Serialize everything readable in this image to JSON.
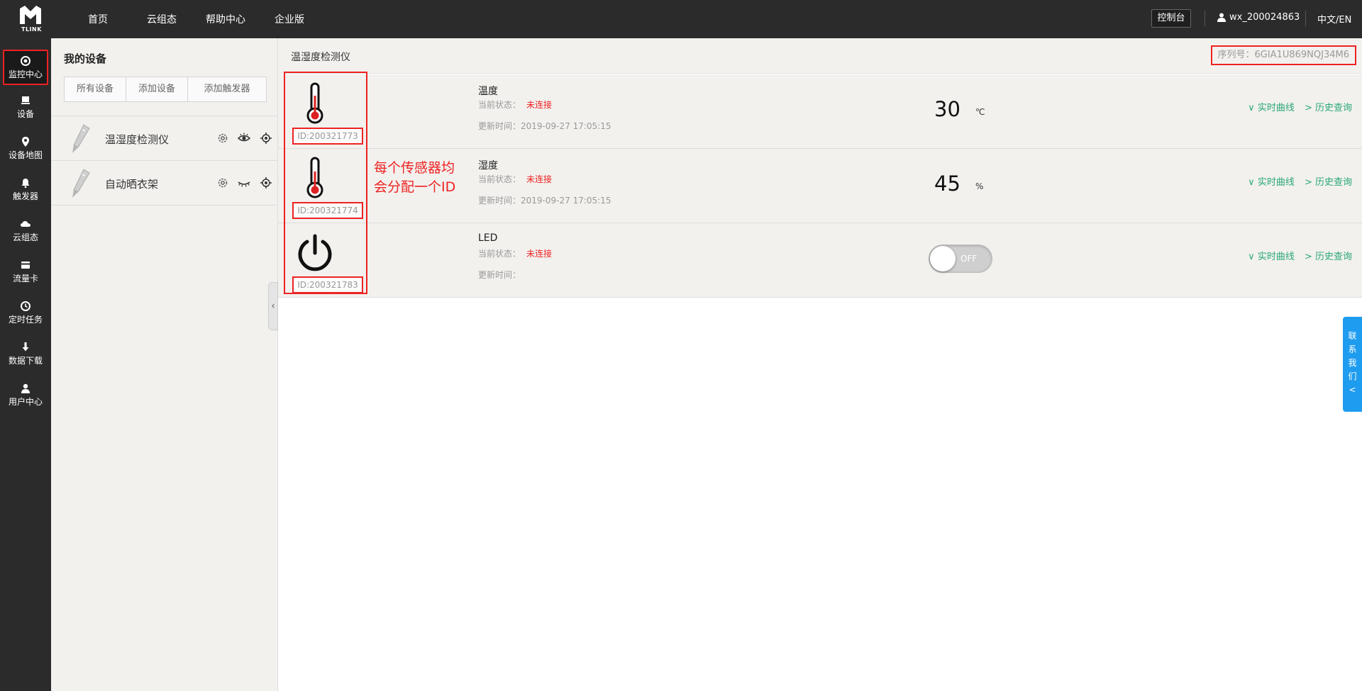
{
  "brand": {
    "logo_text": "TLINK"
  },
  "topnav": {
    "items": [
      "首页",
      "云组态",
      "帮助中心",
      "企业版"
    ],
    "console_label": "控制台",
    "username": "wx_200024863",
    "language": "中文/EN"
  },
  "sidebar": {
    "items": [
      {
        "label": "监控中心",
        "icon": "monitor-icon"
      },
      {
        "label": "设备",
        "icon": "device-icon"
      },
      {
        "label": "设备地图",
        "icon": "map-pin-icon"
      },
      {
        "label": "触发器",
        "icon": "bell-icon"
      },
      {
        "label": "云组态",
        "icon": "cloud-icon"
      },
      {
        "label": "流量卡",
        "icon": "card-icon"
      },
      {
        "label": "定时任务",
        "icon": "clock-icon"
      },
      {
        "label": "数据下载",
        "icon": "download-icon"
      },
      {
        "label": "用户中心",
        "icon": "user-icon"
      }
    ]
  },
  "device_panel": {
    "title": "我的设备",
    "tabs": [
      "所有设备",
      "添加设备",
      "添加触发器"
    ],
    "devices": [
      {
        "name": "温湿度检测仪"
      },
      {
        "name": "自动晒衣架"
      }
    ]
  },
  "main": {
    "title": "温湿度检测仪",
    "serial": "序列号：6GIA1U869NQJ34M6",
    "status_label": "当前状态：",
    "update_label": "更新时间：",
    "link_realtime": "∨ 实时曲线",
    "link_history": "> 历史查询",
    "sensors": [
      {
        "id": "ID:200321773",
        "name": "温度",
        "status": "未连接",
        "updated": "2019-09-27 17:05:15",
        "value": "30",
        "unit": "℃",
        "icon": "thermometer-icon"
      },
      {
        "id": "ID:200321774",
        "name": "湿度",
        "status": "未连接",
        "updated": "2019-09-27 17:05:15",
        "value": "45",
        "unit": "%",
        "icon": "thermometer-icon"
      },
      {
        "id": "ID:200321783",
        "name": "LED",
        "status": "未连接",
        "updated": "",
        "toggle_label": "OFF",
        "icon": "power-icon"
      }
    ]
  },
  "annotation": {
    "line1": "每个传感器均",
    "line2": "会分配一个ID"
  },
  "contact": {
    "chars": [
      "联",
      "系",
      "我",
      "们",
      "<"
    ]
  },
  "colors": {
    "topbar": "#2b2b2b",
    "accent_green": "#2aa876",
    "alert_red": "#e22222",
    "contact_blue": "#1e9cf0"
  }
}
